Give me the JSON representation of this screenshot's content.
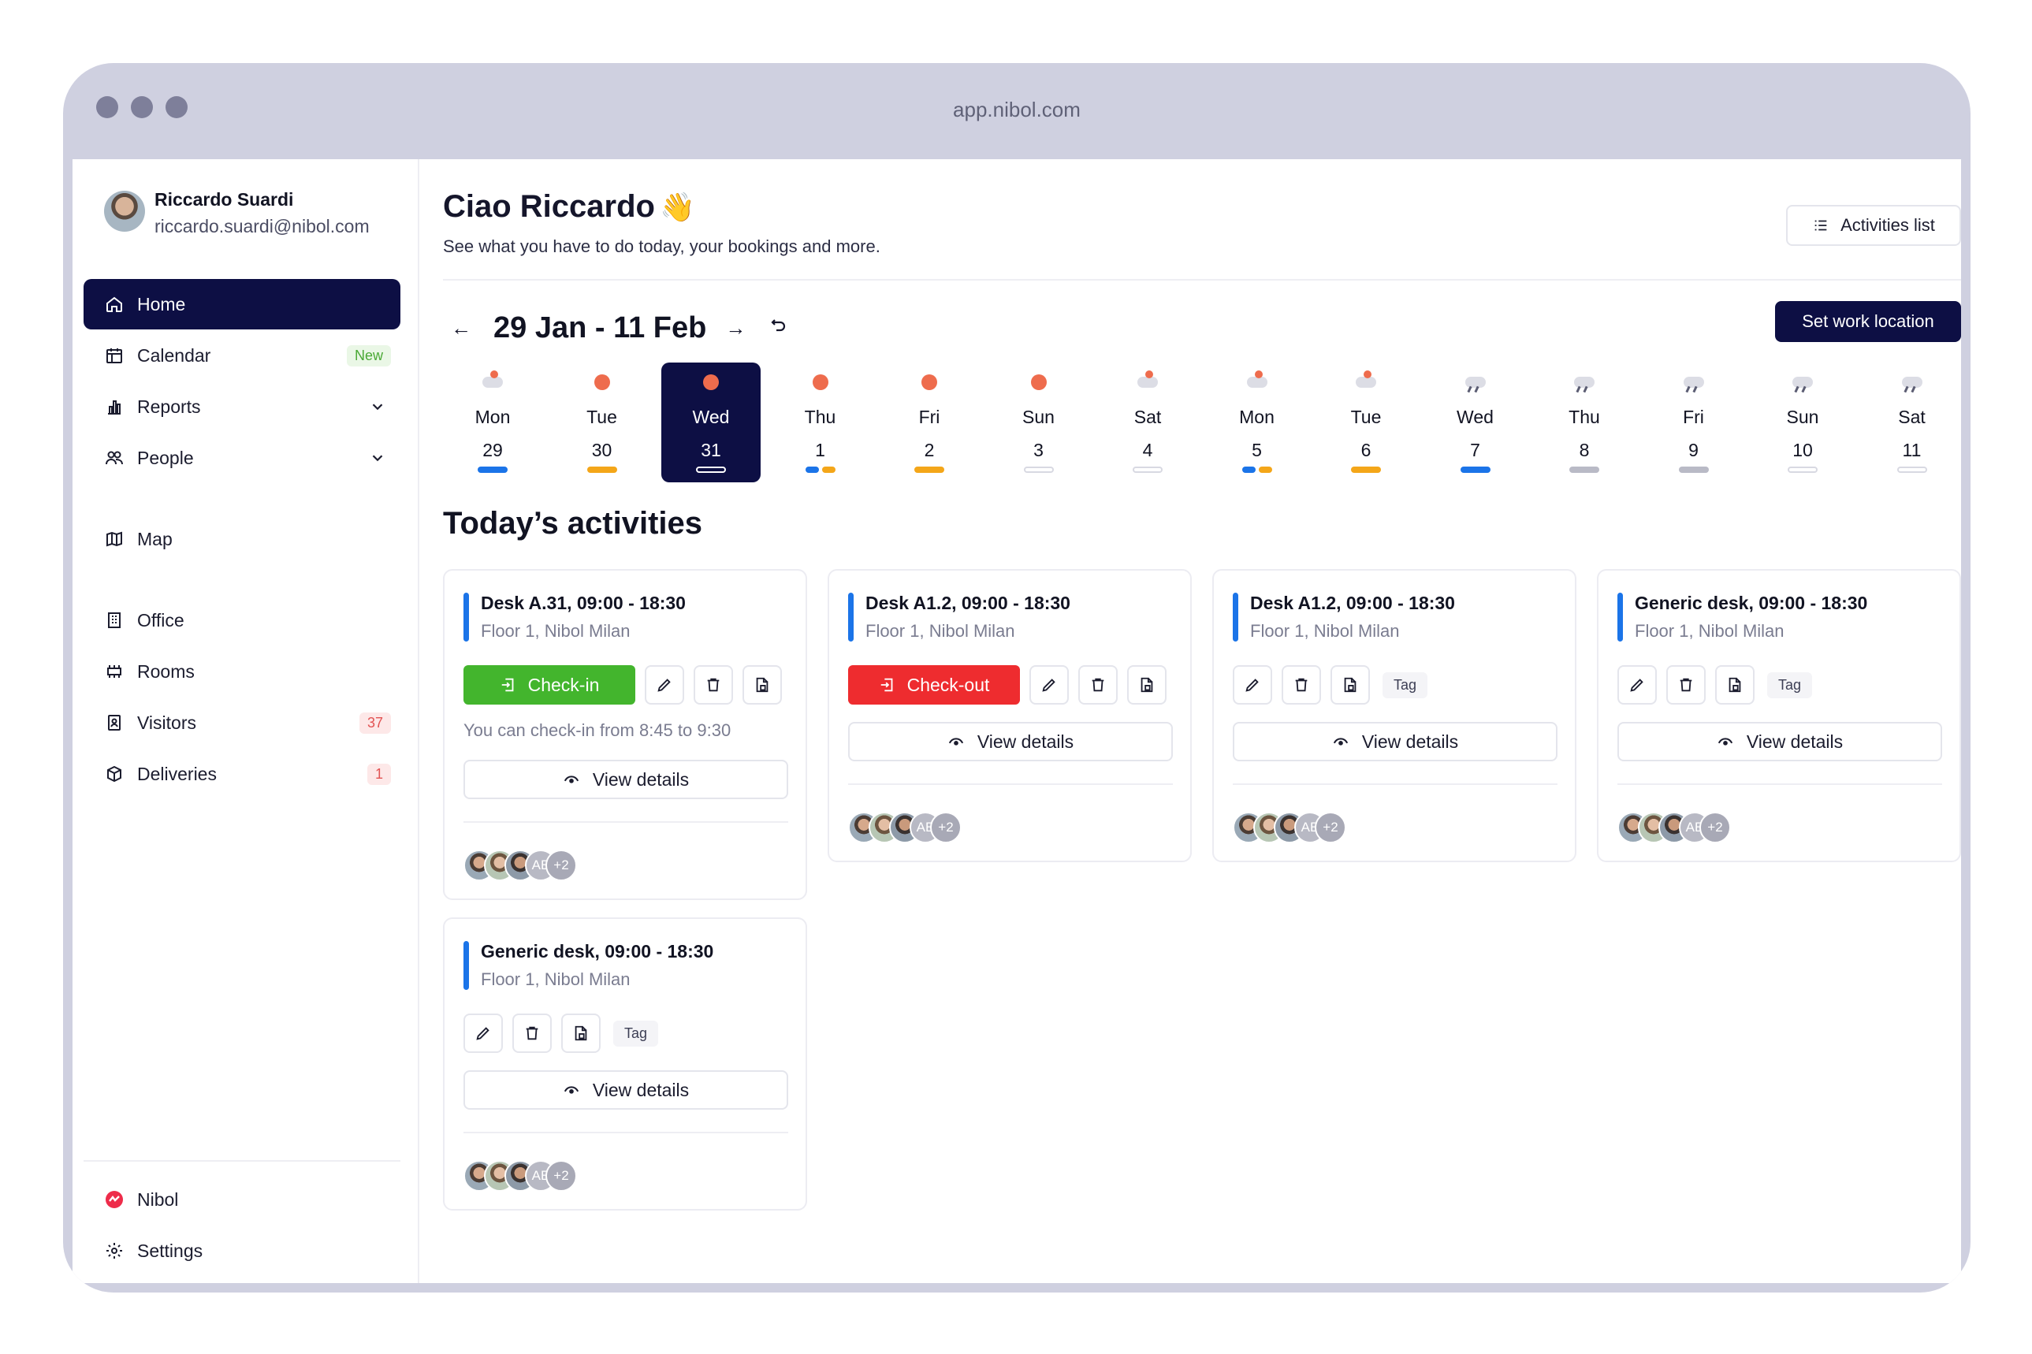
{
  "browser": {
    "url": "app.nibol.com"
  },
  "user": {
    "name": "Riccardo Suardi",
    "email": "riccardo.suardi@nibol.com"
  },
  "sidebar": {
    "items": [
      {
        "label": "Home",
        "icon": "home-icon"
      },
      {
        "label": "Calendar",
        "icon": "calendar-icon",
        "badge": "New"
      },
      {
        "label": "Reports",
        "icon": "reports-icon"
      },
      {
        "label": "People",
        "icon": "people-icon"
      },
      {
        "label": "Map",
        "icon": "map-icon"
      },
      {
        "label": "Office",
        "icon": "office-icon"
      },
      {
        "label": "Rooms",
        "icon": "rooms-icon"
      },
      {
        "label": "Visitors",
        "icon": "visitors-icon",
        "badge": "37"
      },
      {
        "label": "Deliveries",
        "icon": "deliveries-icon",
        "badge": "1"
      }
    ],
    "footer": [
      {
        "label": "Nibol",
        "icon": "nibol-logo-icon"
      },
      {
        "label": "Settings",
        "icon": "gear-icon"
      }
    ]
  },
  "header": {
    "greeting": "Ciao Riccardo",
    "greeting_emoji": "👋",
    "subtitle": "See what you have to do today, your bookings and more.",
    "activities_list_label": "Activities list"
  },
  "week": {
    "range": "29 Jan - 11 Feb",
    "set_location_label": "Set work location",
    "days": [
      {
        "name": "Mon",
        "num": "29",
        "weather": "partly-cloudy",
        "bars": [
          "blue"
        ]
      },
      {
        "name": "Tue",
        "num": "30",
        "weather": "sunny",
        "bars": [
          "orange"
        ]
      },
      {
        "name": "Wed",
        "num": "31",
        "weather": "sunny",
        "bars": [
          "empty"
        ],
        "selected": true
      },
      {
        "name": "Thu",
        "num": "1",
        "weather": "sunny",
        "bars": [
          "blue",
          "orange"
        ]
      },
      {
        "name": "Fri",
        "num": "2",
        "weather": "sunny",
        "bars": [
          "orange"
        ]
      },
      {
        "name": "Sun",
        "num": "3",
        "weather": "sunny",
        "bars": [
          "empty"
        ]
      },
      {
        "name": "Sat",
        "num": "4",
        "weather": "partly-cloudy",
        "bars": [
          "empty"
        ]
      },
      {
        "name": "Mon",
        "num": "5",
        "weather": "partly-cloudy",
        "bars": [
          "blue",
          "orange"
        ]
      },
      {
        "name": "Tue",
        "num": "6",
        "weather": "partly-cloudy",
        "bars": [
          "orange"
        ]
      },
      {
        "name": "Wed",
        "num": "7",
        "weather": "rain",
        "bars": [
          "blue"
        ]
      },
      {
        "name": "Thu",
        "num": "8",
        "weather": "rain",
        "bars": [
          "grey"
        ]
      },
      {
        "name": "Fri",
        "num": "9",
        "weather": "rain",
        "bars": [
          "grey"
        ]
      },
      {
        "name": "Sun",
        "num": "10",
        "weather": "rain",
        "bars": [
          "empty"
        ]
      },
      {
        "name": "Sat",
        "num": "11",
        "weather": "rain",
        "bars": [
          "empty"
        ]
      }
    ]
  },
  "activities": {
    "title": "Today’s activities",
    "view_details_label": "View details",
    "tag_label": "Tag",
    "avatar_initials": "AE",
    "avatar_more": "+2",
    "cards": [
      {
        "title": "Desk A.31, 09:00 - 18:30",
        "location": "Floor 1, Nibol Milan",
        "action": "Check-in",
        "hint": "You can check-in from 8:45 to 9:30"
      },
      {
        "title": "Desk A1.2, 09:00 - 18:30",
        "location": "Floor 1, Nibol Milan",
        "action": "Check-out"
      },
      {
        "title": "Desk A1.2, 09:00 - 18:30",
        "location": "Floor 1, Nibol Milan"
      },
      {
        "title": "Generic desk, 09:00 - 18:30",
        "location": "Floor 1, Nibol Milan"
      },
      {
        "title": "Generic desk, 09:00 - 18:30",
        "location": "Floor 1, Nibol Milan"
      }
    ]
  },
  "colors": {
    "primary": "#0d0f44",
    "checkin": "#43b52d",
    "checkout": "#ee2c2f",
    "accent_blue": "#1b74e8",
    "accent_orange": "#f4a619"
  }
}
